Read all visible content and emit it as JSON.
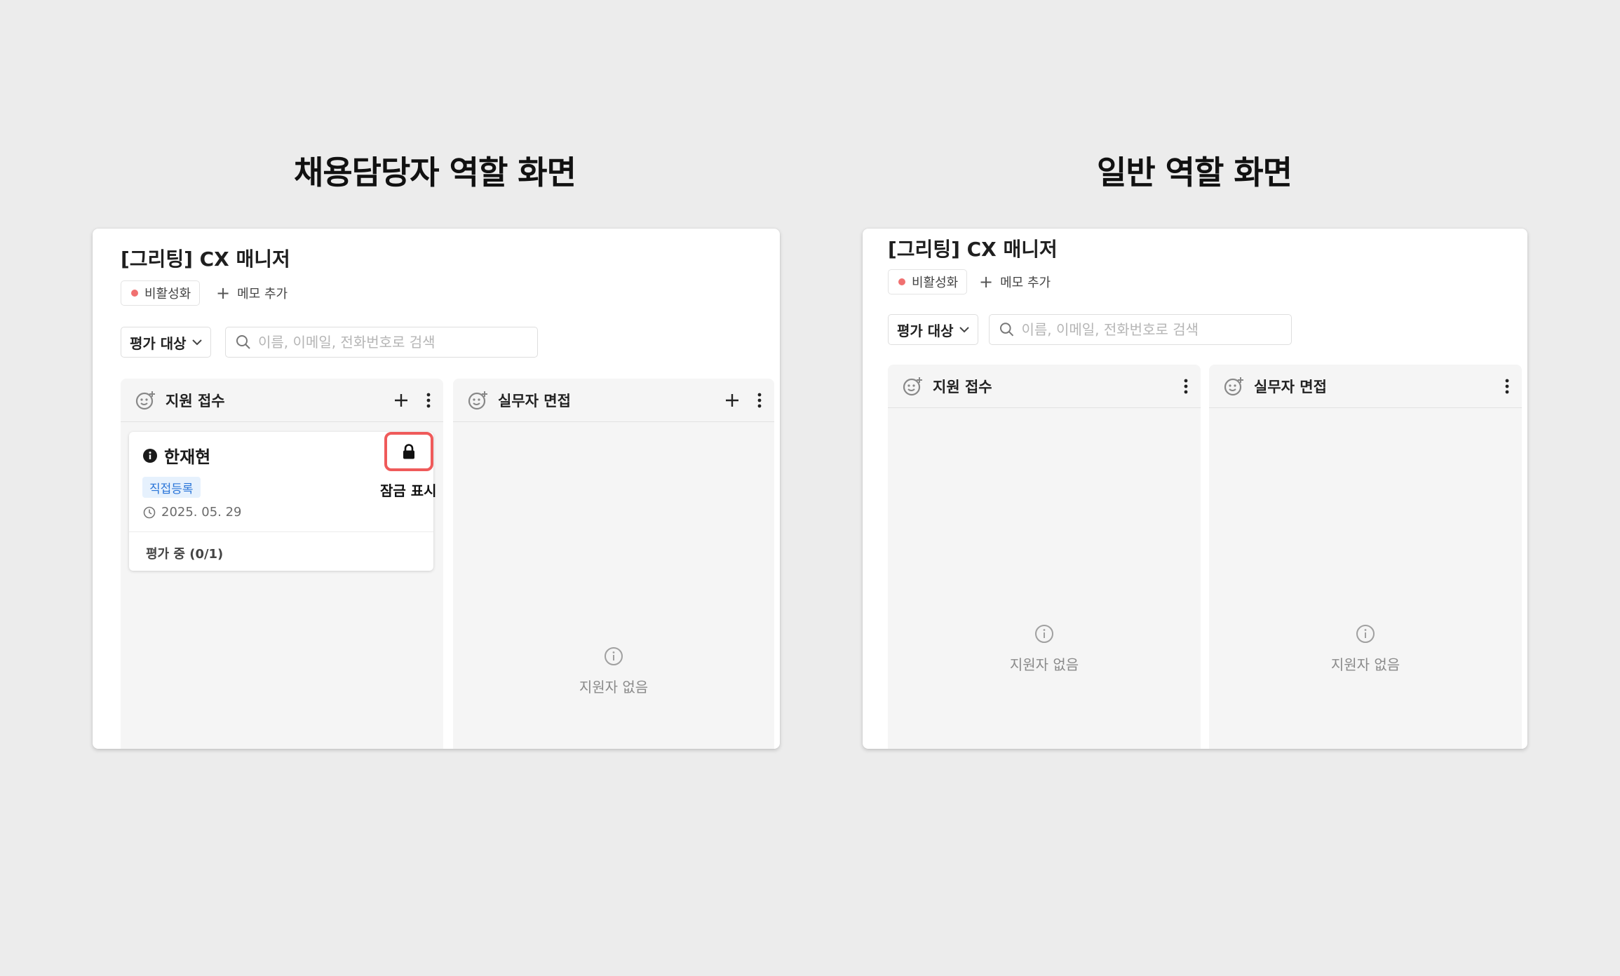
{
  "headings": {
    "left": "채용담당자 역할 화면",
    "right": "일반 역할 화면"
  },
  "recruiter_view": {
    "title": "[그리팅] CX 매니저",
    "status_chip": "비활성화",
    "memo_add": "메모 추가",
    "filter": {
      "selected": "평가 대상"
    },
    "search": {
      "placeholder": "이름, 이메일, 전화번호로 검색"
    },
    "columns": [
      {
        "title": "지원 접수",
        "cards": [
          {
            "name": "한재현",
            "tag": "직접등록",
            "date": "2025. 05. 29",
            "status": "평가 중 (0/1)",
            "lock_label": "잠금 표시"
          }
        ]
      },
      {
        "title": "실무자 면접",
        "empty_text": "지원자 없음"
      }
    ]
  },
  "general_view": {
    "title": "[그리팅] CX 매니저",
    "status_chip": "비활성화",
    "memo_add": "메모 추가",
    "filter": {
      "selected": "평가 대상"
    },
    "search": {
      "placeholder": "이름, 이메일, 전화번호로 검색"
    },
    "columns": [
      {
        "title": "지원 접수",
        "empty_text": "지원자 없음"
      },
      {
        "title": "실무자 면접",
        "empty_text": "지원자 없음"
      }
    ]
  },
  "colors": {
    "background": "#ececec",
    "status_dot": "#f07070",
    "tag_bg": "#e6f1fd",
    "tag_text": "#2a75d8",
    "highlight_border": "#ef5a5a"
  }
}
